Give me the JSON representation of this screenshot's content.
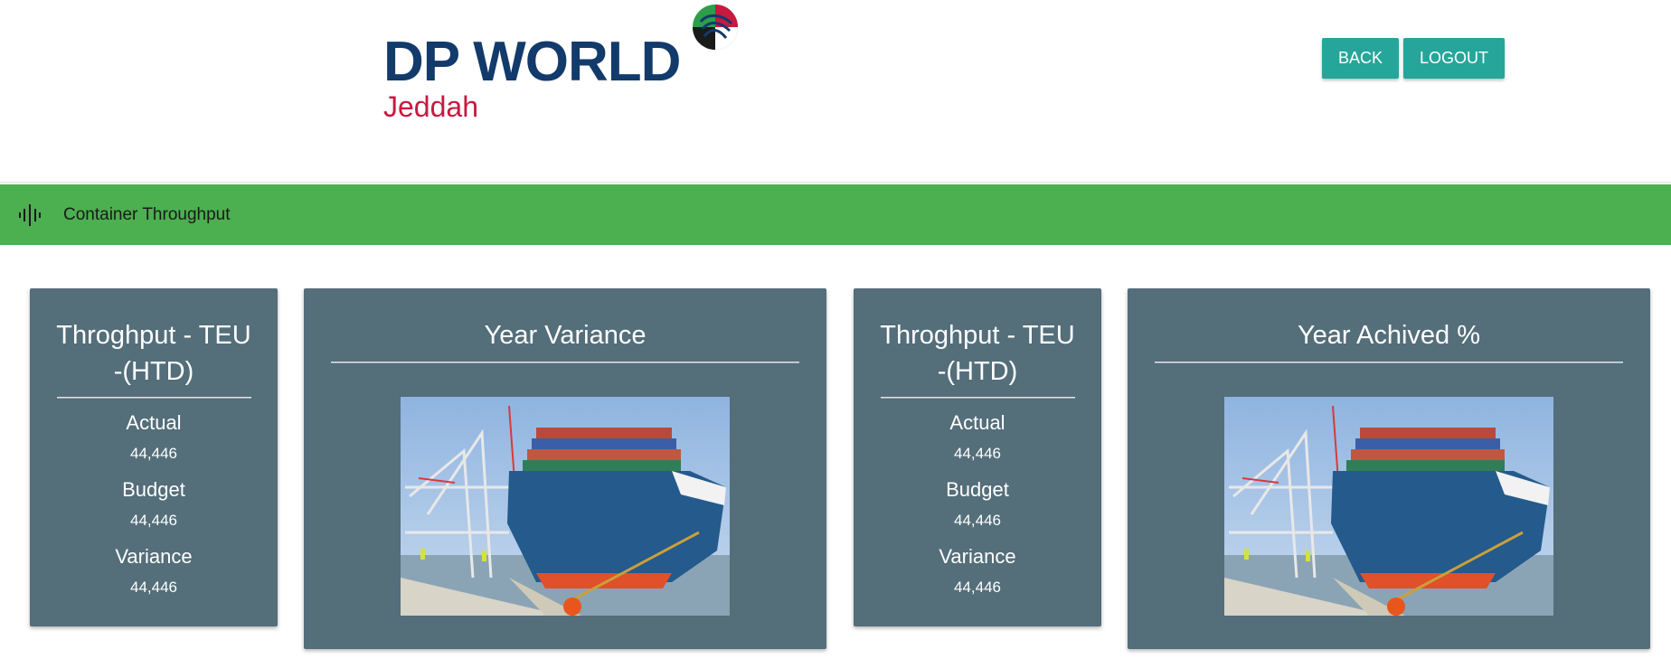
{
  "header": {
    "logo_text": "DP WORLD",
    "logo_subtext": "Jeddah",
    "buttons": {
      "back": "BACK",
      "logout": "LOGOUT"
    }
  },
  "nav": {
    "icon": "audio-waveform-icon",
    "label": "Container Throughput"
  },
  "cards": {
    "htd_1": {
      "title_line1": "Throghput - TEU",
      "title_line2": "-(HTD)",
      "actual_label": "Actual",
      "actual_value": "44,446",
      "budget_label": "Budget",
      "budget_value": "44,446",
      "variance_label": "Variance",
      "variance_value": "44,446"
    },
    "year_variance": {
      "title": "Year Variance"
    },
    "htd_2": {
      "title_line1": "Throghput - TEU",
      "title_line2": "-(HTD)",
      "actual_label": "Actual",
      "actual_value": "44,446",
      "budget_label": "Budget",
      "budget_value": "44,446",
      "variance_label": "Variance",
      "variance_value": "44,446"
    },
    "year_achieved": {
      "title": "Year Achived %"
    }
  },
  "colors": {
    "nav_green": "#4caf50",
    "button_teal": "#26a69a",
    "card_slate": "#546e7a",
    "logo_blue": "#123a6b",
    "logo_red": "#c8193f"
  }
}
